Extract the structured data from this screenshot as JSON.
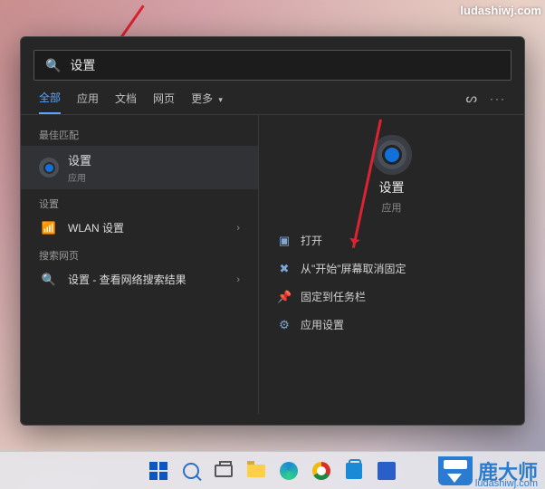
{
  "watermark": "ludashiwj.com",
  "brand": {
    "name": "鹿大师",
    "sub": "ludashiwj.com"
  },
  "search": {
    "value": "设置"
  },
  "tabs": {
    "items": [
      {
        "label": "全部",
        "active": true
      },
      {
        "label": "应用"
      },
      {
        "label": "文档"
      },
      {
        "label": "网页"
      },
      {
        "label": "更多"
      }
    ]
  },
  "left": {
    "best_match_label": "最佳匹配",
    "best": {
      "title": "设置",
      "sub": "应用"
    },
    "settings_label": "设置",
    "wlan": {
      "title": "WLAN 设置"
    },
    "web_label": "搜索网页",
    "web": {
      "title": "设置 - 查看网络搜索结果"
    }
  },
  "detail": {
    "title": "设置",
    "sub": "应用",
    "actions": [
      {
        "icon": "open",
        "label": "打开"
      },
      {
        "icon": "unpin",
        "label": "从\"开始\"屏幕取消固定"
      },
      {
        "icon": "pin",
        "label": "固定到任务栏"
      },
      {
        "icon": "appsettings",
        "label": "应用设置"
      }
    ]
  }
}
